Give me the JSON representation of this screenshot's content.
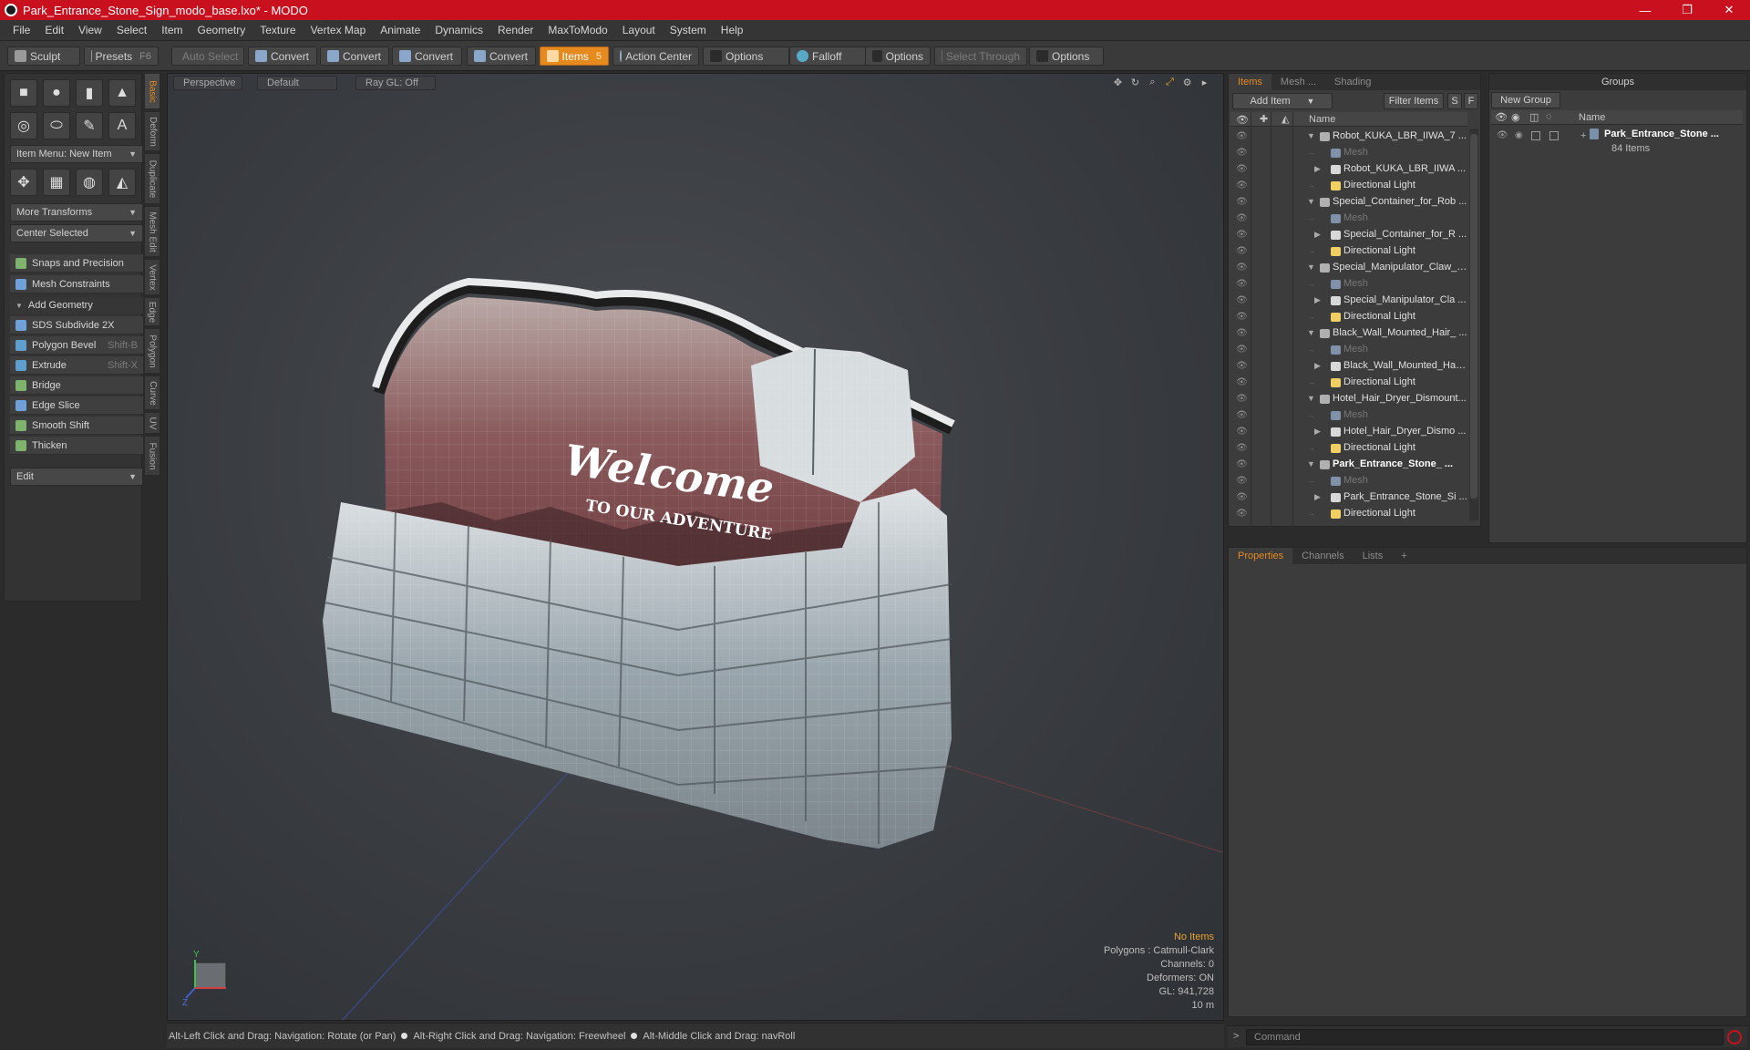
{
  "window": {
    "title": "Park_Entrance_Stone_Sign_modo_base.lxo* - MODO",
    "controls": [
      "—",
      "❐",
      "✕"
    ]
  },
  "menubar": [
    "File",
    "Edit",
    "View",
    "Select",
    "Item",
    "Geometry",
    "Texture",
    "Vertex Map",
    "Animate",
    "Dynamics",
    "Render",
    "MaxToModo",
    "Layout",
    "System",
    "Help"
  ],
  "toolbar": {
    "sculpt": "Sculpt",
    "presets": "Presets",
    "presets_shortcut": "F6",
    "auto_select": "Auto Select",
    "convert": "Convert",
    "items": "Items",
    "items_count": "5",
    "action_center": "Action Center",
    "options": "Options",
    "falloff": "Falloff",
    "select_through": "Select Through"
  },
  "leftpanel": {
    "item_menu": "Item Menu: New Item",
    "more_transforms": "More Transforms",
    "center_selected": "Center Selected",
    "snaps": "Snaps and Precision",
    "mesh_constraints": "Mesh Constraints",
    "add_geometry": "Add Geometry",
    "tools": [
      {
        "label": "SDS Subdivide 2X",
        "shortcut": ""
      },
      {
        "label": "Polygon Bevel",
        "shortcut": "Shift-B"
      },
      {
        "label": "Extrude",
        "shortcut": "Shift-X"
      },
      {
        "label": "Bridge",
        "shortcut": ""
      },
      {
        "label": "Edge Slice",
        "shortcut": ""
      },
      {
        "label": "Smooth Shift",
        "shortcut": ""
      },
      {
        "label": "Thicken",
        "shortcut": ""
      }
    ],
    "edit": "Edit"
  },
  "vtabs": [
    "Basic",
    "Deform",
    "Duplicate",
    "Mesh Edit",
    "Vertex",
    "Edge",
    "Polygon",
    "Curve",
    "UV",
    "Fusion"
  ],
  "viewport": {
    "view": "Perspective",
    "style": "Default",
    "raygl": "Ray GL: Off",
    "sign_title": "Welcome",
    "sign_sub": "TO OUR ADVENTURE",
    "info": {
      "selection": "No Items",
      "polygons": "Polygons : Catmull-Clark",
      "channels": "Channels: 0",
      "deformers": "Deformers: ON",
      "gl": "GL: 941,728",
      "scale": "10 m"
    },
    "axes": {
      "y": "Y",
      "z": "Z"
    }
  },
  "statusbar": [
    "Alt-Left Click and Drag: Navigation: Rotate (or Pan)",
    "Alt-Right Click and Drag: Navigation: Freewheel",
    "Alt-Middle Click and Drag: navRoll"
  ],
  "items_panel": {
    "tabs": [
      "Items",
      "Mesh ...",
      "Shading"
    ],
    "add_item": "Add Item",
    "filter_items": "Filter Items",
    "s": "S",
    "f": "F",
    "col_name": "Name",
    "rows": [
      {
        "label": "Robot_KUKA_LBR_IIWA_7 ...",
        "level": 0,
        "type": "scene",
        "expanded": true
      },
      {
        "label": "Mesh",
        "level": 1,
        "type": "mesh",
        "dim": true
      },
      {
        "label": "Robot_KUKA_LBR_IIWA ...",
        "level": 1,
        "type": "locator",
        "collapsed": true
      },
      {
        "label": "Directional Light",
        "level": 1,
        "type": "light"
      },
      {
        "label": "Special_Container_for_Rob ...",
        "level": 0,
        "type": "scene",
        "expanded": true
      },
      {
        "label": "Mesh",
        "level": 1,
        "type": "mesh",
        "dim": true
      },
      {
        "label": "Special_Container_for_R ...",
        "level": 1,
        "type": "locator",
        "collapsed": true
      },
      {
        "label": "Directional Light",
        "level": 1,
        "type": "light"
      },
      {
        "label": "Special_Manipulator_Claw_ ...",
        "level": 0,
        "type": "scene",
        "expanded": true
      },
      {
        "label": "Mesh",
        "level": 1,
        "type": "mesh",
        "dim": true
      },
      {
        "label": "Special_Manipulator_Cla ...",
        "level": 1,
        "type": "locator",
        "collapsed": true
      },
      {
        "label": "Directional Light",
        "level": 1,
        "type": "light"
      },
      {
        "label": "Black_Wall_Mounted_Hair_ ...",
        "level": 0,
        "type": "scene",
        "expanded": true
      },
      {
        "label": "Mesh",
        "level": 1,
        "type": "mesh",
        "dim": true
      },
      {
        "label": "Black_Wall_Mounted_Hai ...",
        "level": 1,
        "type": "locator",
        "collapsed": true
      },
      {
        "label": "Directional Light",
        "level": 1,
        "type": "light"
      },
      {
        "label": "Hotel_Hair_Dryer_Dismount...",
        "level": 0,
        "type": "scene",
        "expanded": true
      },
      {
        "label": "Mesh",
        "level": 1,
        "type": "mesh",
        "dim": true
      },
      {
        "label": "Hotel_Hair_Dryer_Dismo ...",
        "level": 1,
        "type": "locator",
        "collapsed": true
      },
      {
        "label": "Directional Light",
        "level": 1,
        "type": "light"
      },
      {
        "label": "Park_Entrance_Stone_ ...",
        "level": 0,
        "type": "scene",
        "expanded": true,
        "bold": true
      },
      {
        "label": "Mesh",
        "level": 1,
        "type": "mesh",
        "dim": true
      },
      {
        "label": "Park_Entrance_Stone_Si ...",
        "level": 1,
        "type": "locator",
        "collapsed": true
      },
      {
        "label": "Directional Light",
        "level": 1,
        "type": "light"
      }
    ]
  },
  "groups_panel": {
    "title": "Groups",
    "new_group": "New Group",
    "col_name": "Name",
    "group_name": "Park_Entrance_Stone ...",
    "group_count": "84 Items"
  },
  "props_panel": {
    "tabs": [
      "Properties",
      "Channels",
      "Lists"
    ],
    "add": "+"
  },
  "command": {
    "placeholder": "Command",
    "prompt": ">"
  },
  "colors": {
    "accent": "#e58a1f",
    "titlebar": "#c9101e",
    "sign_text": "#ffffff",
    "sign_panel": "#7a4448"
  }
}
